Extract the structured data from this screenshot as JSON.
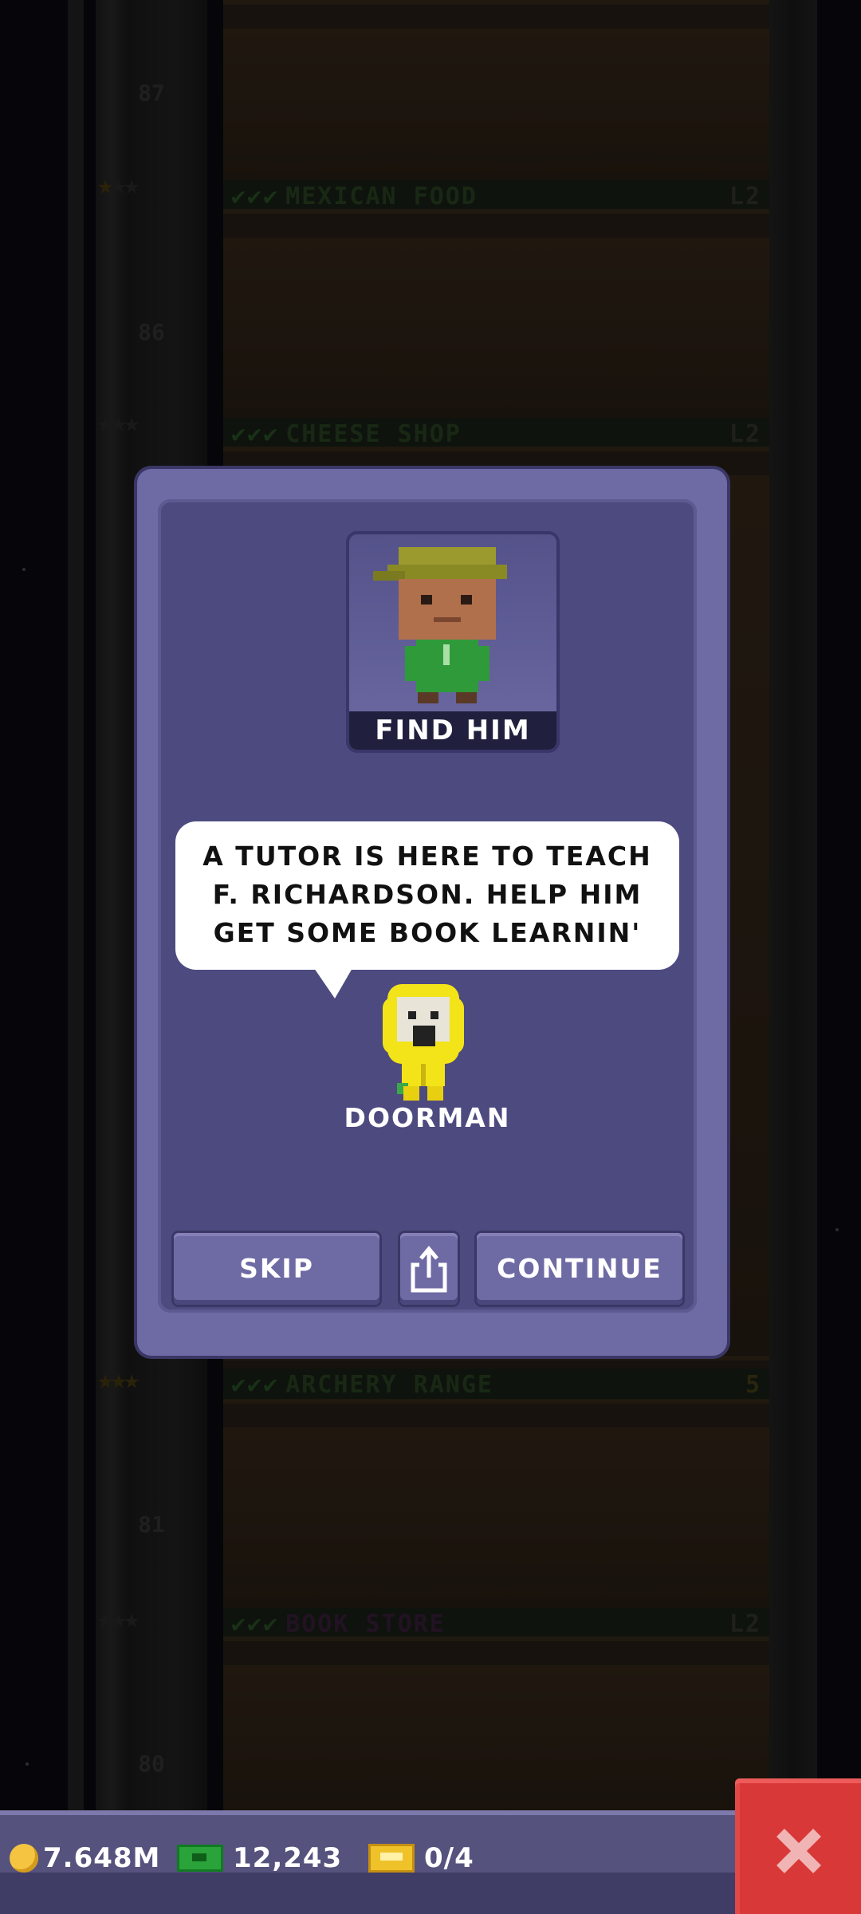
{
  "background_floors": [
    {
      "number": "87",
      "name": "MEXICAN FOOD",
      "checks": "✔✔✔",
      "level": "L2"
    },
    {
      "number": "86",
      "name": "CHEESE SHOP",
      "checks": "✔✔✔",
      "level": "L2"
    },
    {
      "number": "",
      "name": "ARCHERY RANGE",
      "checks": "✔✔✔",
      "level": "5"
    },
    {
      "number": "81",
      "name": "BOOK STORE",
      "checks": "✔✔✔",
      "level": "L2"
    },
    {
      "number": "80",
      "name": "",
      "checks": "",
      "level": ""
    }
  ],
  "dialog": {
    "portrait_caption": "FIND HIM",
    "message": "A TUTOR IS HERE TO TEACH F. RICHARDSON. HELP HIM GET SOME BOOK LEARNIN'",
    "speaker_name": "DOORMAN",
    "buttons": {
      "skip": "SKIP",
      "share_icon": "share-icon",
      "continue": "CONTINUE"
    }
  },
  "status_bar": {
    "coins": "7.648M",
    "bux": "12,243",
    "tickets": "0/4",
    "icons": [
      "coin-icon",
      "bux-icon",
      "ticket-icon"
    ]
  },
  "close_icon": "close-icon",
  "colors": {
    "dialog_frame": "#6e6aa4",
    "dialog_inner": "#4d4a80",
    "close_button": "#d93838",
    "status_bar": "#55527e"
  }
}
